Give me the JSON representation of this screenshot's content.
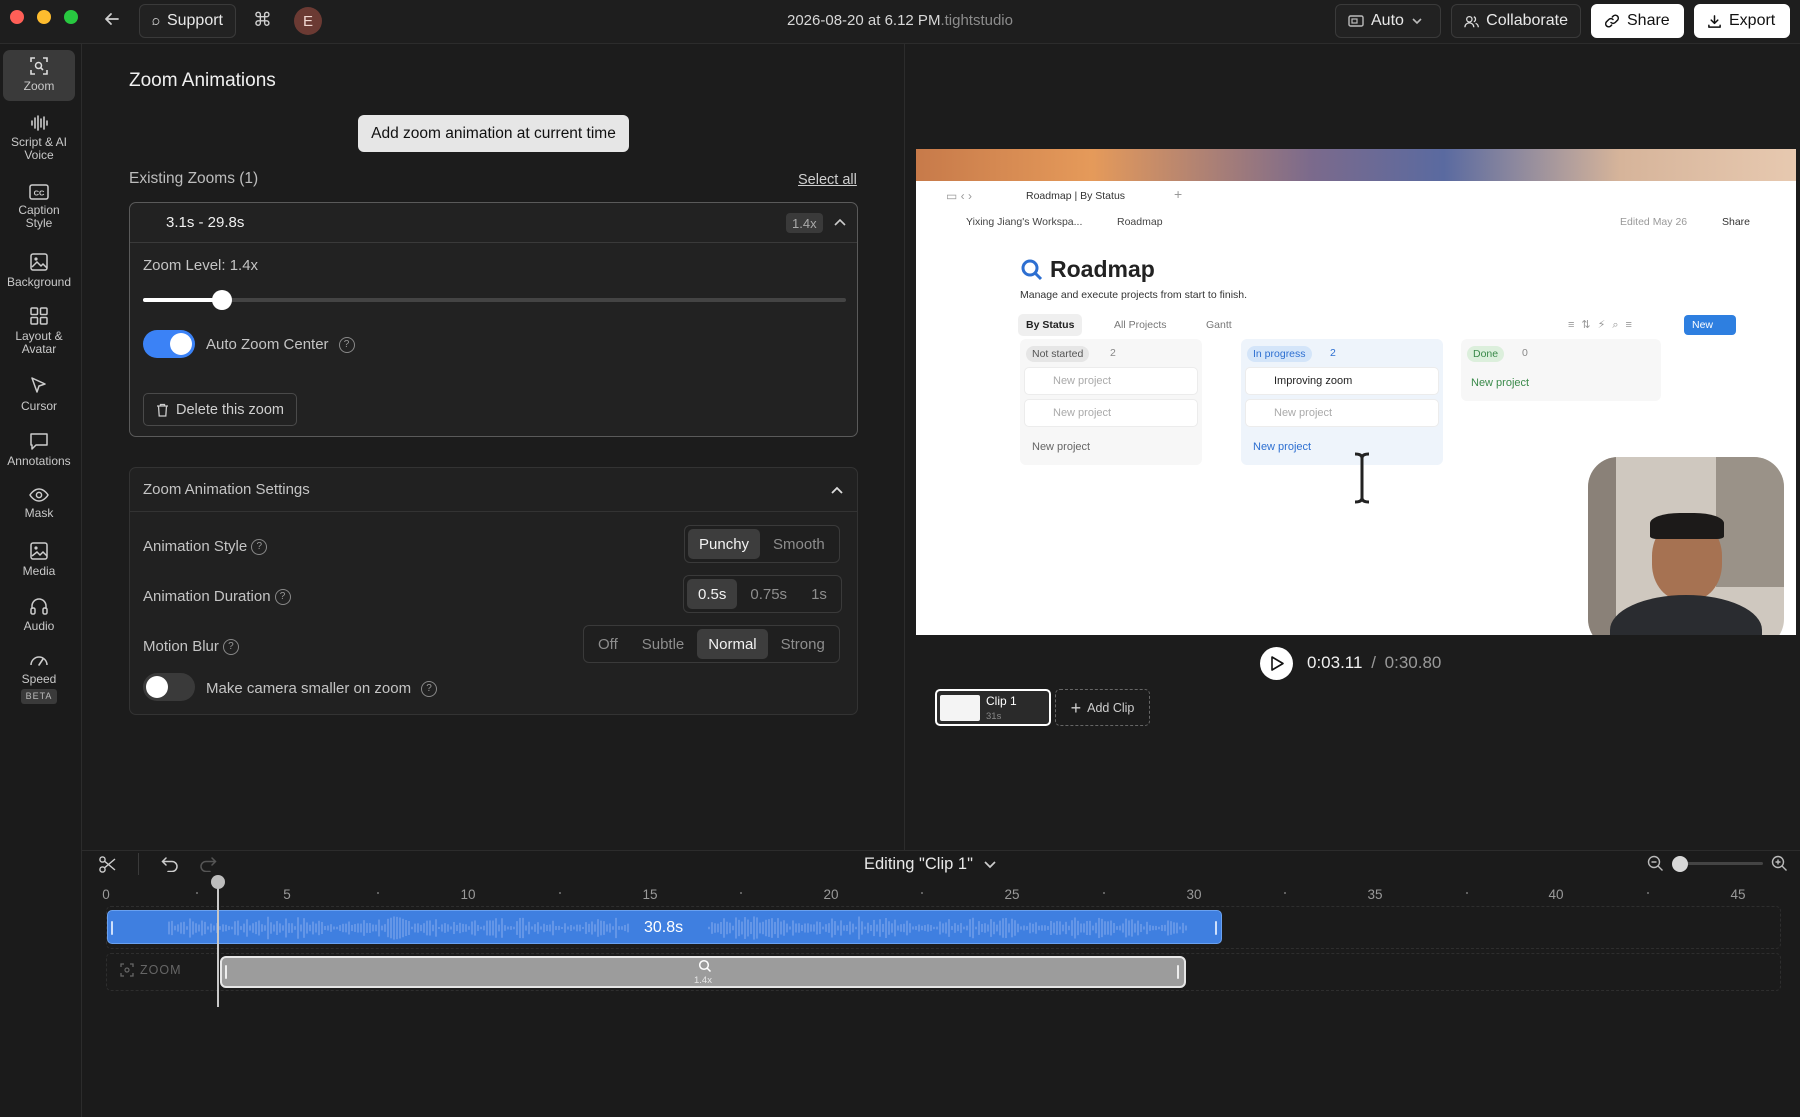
{
  "window": {
    "title_main": "2026-08-20 at 6.12 PM",
    "title_ext": ".tightstudio",
    "support_label": "Support",
    "avatar_initial": "E",
    "auto_label": "Auto",
    "collaborate_label": "Collaborate",
    "share_label": "Share",
    "export_label": "Export"
  },
  "sidebar": {
    "items": [
      {
        "label": "Zoom",
        "icon": "zoom-frame-icon",
        "active": true
      },
      {
        "label": "Script & AI Voice",
        "icon": "waveform-icon"
      },
      {
        "label": "Caption Style",
        "icon": "cc-icon"
      },
      {
        "label": "Background",
        "icon": "image-icon"
      },
      {
        "label": "Layout & Avatar",
        "icon": "grid-icon"
      },
      {
        "label": "Cursor",
        "icon": "cursor-icon"
      },
      {
        "label": "Annotations",
        "icon": "speech-bubble-icon"
      },
      {
        "label": "Mask",
        "icon": "eye-icon"
      },
      {
        "label": "Media",
        "icon": "media-icon"
      },
      {
        "label": "Audio",
        "icon": "headphones-icon"
      },
      {
        "label": "Speed",
        "icon": "gauge-icon",
        "badge": "BETA"
      }
    ]
  },
  "panel": {
    "title": "Zoom Animations",
    "add_button": "Add zoom animation at current time",
    "existing_label": "Existing Zooms (1)",
    "select_all": "Select all",
    "zoom": {
      "range": "3.1s - 29.8s",
      "badge": "1.4x",
      "level_label": "Zoom Level: 1.4x",
      "level_fraction": 0.113,
      "auto_center_label": "Auto Zoom Center",
      "auto_center_on": true,
      "delete_label": "Delete this zoom"
    },
    "settings": {
      "title": "Zoom Animation Settings",
      "style_label": "Animation Style",
      "style_options": [
        "Punchy",
        "Smooth"
      ],
      "style_selected": "Punchy",
      "duration_label": "Animation Duration",
      "duration_options": [
        "0.5s",
        "0.75s",
        "1s"
      ],
      "duration_selected": "0.5s",
      "blur_label": "Motion Blur",
      "blur_options": [
        "Off",
        "Subtle",
        "Normal",
        "Strong"
      ],
      "blur_selected": "Normal",
      "camera_label": "Make camera smaller on zoom",
      "camera_on": false
    }
  },
  "preview": {
    "tab_title": "Roadmap | By Status",
    "crumb_workspace": "Yixing Jiang's Workspa...",
    "crumb_page": "Roadmap",
    "edited": "Edited May 26",
    "share": "Share",
    "page_title": "Roadmap",
    "page_subtitle": "Manage and execute projects from start to finish.",
    "views": [
      "By Status",
      "All Projects",
      "Gantt"
    ],
    "new_button": "New",
    "columns": [
      {
        "name": "Not started",
        "count": "2",
        "cards": [
          "New project",
          "New project"
        ],
        "add": "New project"
      },
      {
        "name": "In progress",
        "count": "2",
        "cards": [
          "Improving zoom",
          "New project"
        ],
        "add": "New project"
      },
      {
        "name": "Done",
        "count": "0",
        "cards": [],
        "add": "New project"
      }
    ]
  },
  "playback": {
    "current": "0:03.11",
    "separator": "/",
    "total": "0:30.80",
    "clip_name": "Clip 1",
    "clip_duration": "31s",
    "add_clip": "Add Clip"
  },
  "timeline": {
    "editing_label": "Editing \"Clip 1\"",
    "ticks": [
      "0",
      "5",
      "10",
      "15",
      "20",
      "25",
      "30",
      "35",
      "40",
      "45"
    ],
    "audio_label": "30.8s",
    "zoom_track_label": "ZOOM",
    "zoom_clip_label": "1.4x",
    "zoom_slider_fraction": 0
  },
  "colors": {
    "accent": "#3f7fe0",
    "toggle_on": "#3b82f6",
    "background": "#1c1c1c"
  }
}
